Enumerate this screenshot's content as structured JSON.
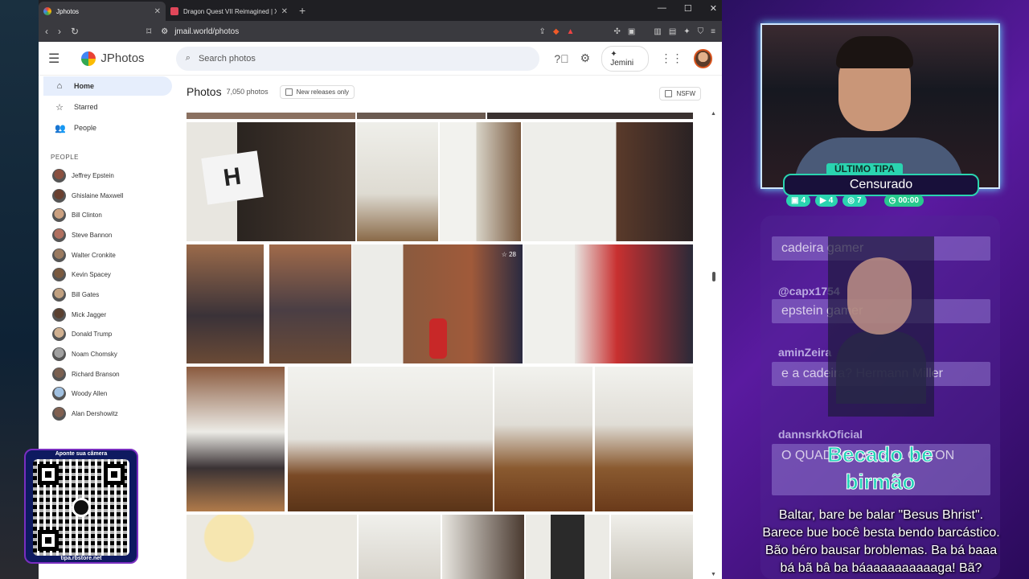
{
  "browser": {
    "tabs": [
      {
        "title": "Jphotos",
        "active": true
      },
      {
        "title": "Dragon Quest VII Reimagined | Xsolla Partne...",
        "active": false
      }
    ],
    "url": "jmail.world/photos"
  },
  "app": {
    "name": "JPhotos",
    "search_placeholder": "Search photos",
    "jemini_label": "Jemini"
  },
  "sidebar": {
    "nav": [
      {
        "label": "Home",
        "icon": "home-icon"
      },
      {
        "label": "Starred",
        "icon": "star-icon"
      },
      {
        "label": "People",
        "icon": "people-icon"
      }
    ],
    "people_header": "PEOPLE",
    "people": [
      "Jeffrey Epstein",
      "Ghislaine Maxwell",
      "Bill Clinton",
      "Steve Bannon",
      "Walter Cronkite",
      "Kevin Spacey",
      "Bill Gates",
      "Mick Jagger",
      "Donald Trump",
      "Noam Chomsky",
      "Richard Branson",
      "Woody Allen",
      "Alan Dershowitz"
    ]
  },
  "main": {
    "title": "Photos",
    "count": "7,050 photos",
    "filter_new": "New releases only",
    "filter_nsfw": "NSFW",
    "star_count": "28"
  },
  "stream": {
    "badge_top": "ÚLTIMO TIPA",
    "badge_main": "Censurado",
    "stats": [
      "4",
      "4",
      "7",
      "00:00"
    ],
    "chat": [
      {
        "user": "",
        "text": "cadeira gamer"
      },
      {
        "user": "@capx1754",
        "text": "epstein gamer"
      },
      {
        "user": "aminZeira",
        "text": "e a cadeira? Hermann Miller"
      },
      {
        "user": "dannsrkkOficial",
        "text": "O QUADRO DO BILL CLITON"
      }
    ],
    "overlay_text": "Becado be birmão",
    "caption": "Baltar, bare be balar \"Besus Bhrist\". Barece bue bocê besta bendo barcástico. Bão béro bausar broblemas. Ba bá baaa bá bã bâ ba báaaaaaaaaaaga! Bã?",
    "qr_label": "Aponte sua câmera",
    "qr_url": "tipa.rbstore.net"
  }
}
